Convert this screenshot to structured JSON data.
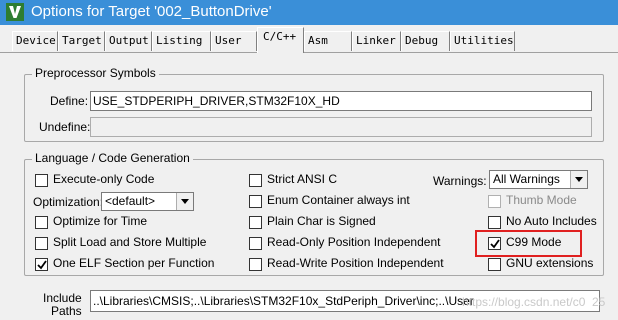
{
  "window": {
    "title": "Options for Target '002_ButtonDrive'",
    "icon": "keil-uvision-icon"
  },
  "tabs": [
    {
      "label": "Device",
      "active": false
    },
    {
      "label": "Target",
      "active": false
    },
    {
      "label": "Output",
      "active": false
    },
    {
      "label": "Listing",
      "active": false
    },
    {
      "label": "User",
      "active": false
    },
    {
      "label": "C/C++",
      "active": true
    },
    {
      "label": "Asm",
      "active": false
    },
    {
      "label": "Linker",
      "active": false
    },
    {
      "label": "Debug",
      "active": false
    },
    {
      "label": "Utilities",
      "active": false
    }
  ],
  "preprocessor": {
    "group_label": "Preprocessor Symbols",
    "define_label": "Define:",
    "define_value": "USE_STDPERIPH_DRIVER,STM32F10X_HD",
    "undefine_label": "Undefine:",
    "undefine_value": ""
  },
  "codegen": {
    "group_label": "Language / Code Generation",
    "execute_only": {
      "label": "Execute-only Code",
      "checked": false
    },
    "optimization_label": "Optimization:",
    "optimization_value": "<default>",
    "optimize_time": {
      "label": "Optimize for Time",
      "checked": false
    },
    "split_load": {
      "label": "Split Load and Store Multiple",
      "checked": false
    },
    "one_elf": {
      "label": "One ELF Section per Function",
      "checked": true
    },
    "strict_ansi": {
      "label": "Strict ANSI C",
      "checked": false
    },
    "enum_container": {
      "label": "Enum Container always int",
      "checked": false
    },
    "plain_char": {
      "label": "Plain Char is Signed",
      "checked": false
    },
    "ro_position": {
      "label": "Read-Only Position Independent",
      "checked": false
    },
    "rw_position": {
      "label": "Read-Write Position Independent",
      "checked": false
    },
    "warnings_label": "Warnings:",
    "warnings_value": "All Warnings",
    "thumb_mode": {
      "label": "Thumb Mode",
      "checked": false,
      "disabled": true
    },
    "no_auto_includes": {
      "label": "No Auto Includes",
      "checked": false
    },
    "c99_mode": {
      "label": "C99 Mode",
      "checked": true
    },
    "gnu_extensions": {
      "label": "GNU extensions",
      "checked": false
    }
  },
  "include": {
    "label_line1": "Include",
    "label_line2": "Paths",
    "value": "..\\Libraries\\CMSIS;..\\Libraries\\STM32F10x_StdPeriph_Driver\\inc;..\\User"
  },
  "watermark": "https://blog.csdn.net/c0",
  "watermark_tail": "25",
  "colors": {
    "titlebar": "#3a8fd8",
    "highlight": "#e02020"
  }
}
